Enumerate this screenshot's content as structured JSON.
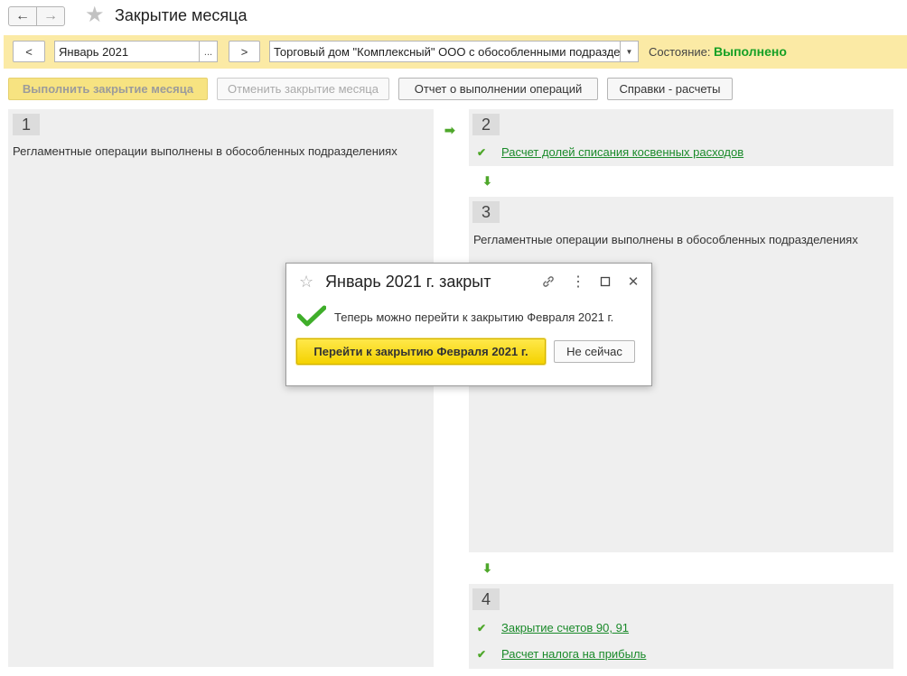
{
  "window": {
    "title": "Закрытие месяца",
    "back_icon": "←",
    "forward_icon": "→",
    "star_icon": "★"
  },
  "filter": {
    "prev_label": "<",
    "period_value": "Январь 2021",
    "period_select_label": "...",
    "next_label": ">",
    "organization_value": "Торговый дом \"Комплексный\" ООО с обособленными подразде",
    "organization_dropdown_icon": "▼",
    "state_label": "Состояние:",
    "state_value": "Выполнено"
  },
  "commands": {
    "perform_label": "Выполнить закрытие месяца",
    "cancel_label": "Отменить закрытие месяца",
    "report_label": "Отчет о выполнении операций",
    "references_label": "Справки - расчеты"
  },
  "panels": {
    "p1": {
      "number": "1",
      "text": "Регламентные операции выполнены в обособленных подразделениях"
    },
    "p2": {
      "number": "2",
      "items": [
        "Расчет долей списания косвенных расходов"
      ]
    },
    "p3": {
      "number": "3",
      "text": "Регламентные операции выполнены в обособленных подразделениях"
    },
    "p4": {
      "number": "4",
      "items": [
        "Закрытие счетов 90, 91",
        "Расчет налога на прибыль"
      ]
    }
  },
  "dialog": {
    "title": "Январь 2021 г. закрыт",
    "message": "Теперь можно перейти к закрытию Февраля 2021 г.",
    "primary_label": "Перейти к закрытию Февраля 2021 г.",
    "secondary_label": "Не сейчас",
    "star_icon": "☆",
    "more_icon": "⋮",
    "close_icon": "✕"
  },
  "colors": {
    "status_green": "#16a025",
    "filter_bg": "#fbeaa5",
    "primary_yellow": "#f4d200",
    "link_green": "#1a8a2a"
  }
}
